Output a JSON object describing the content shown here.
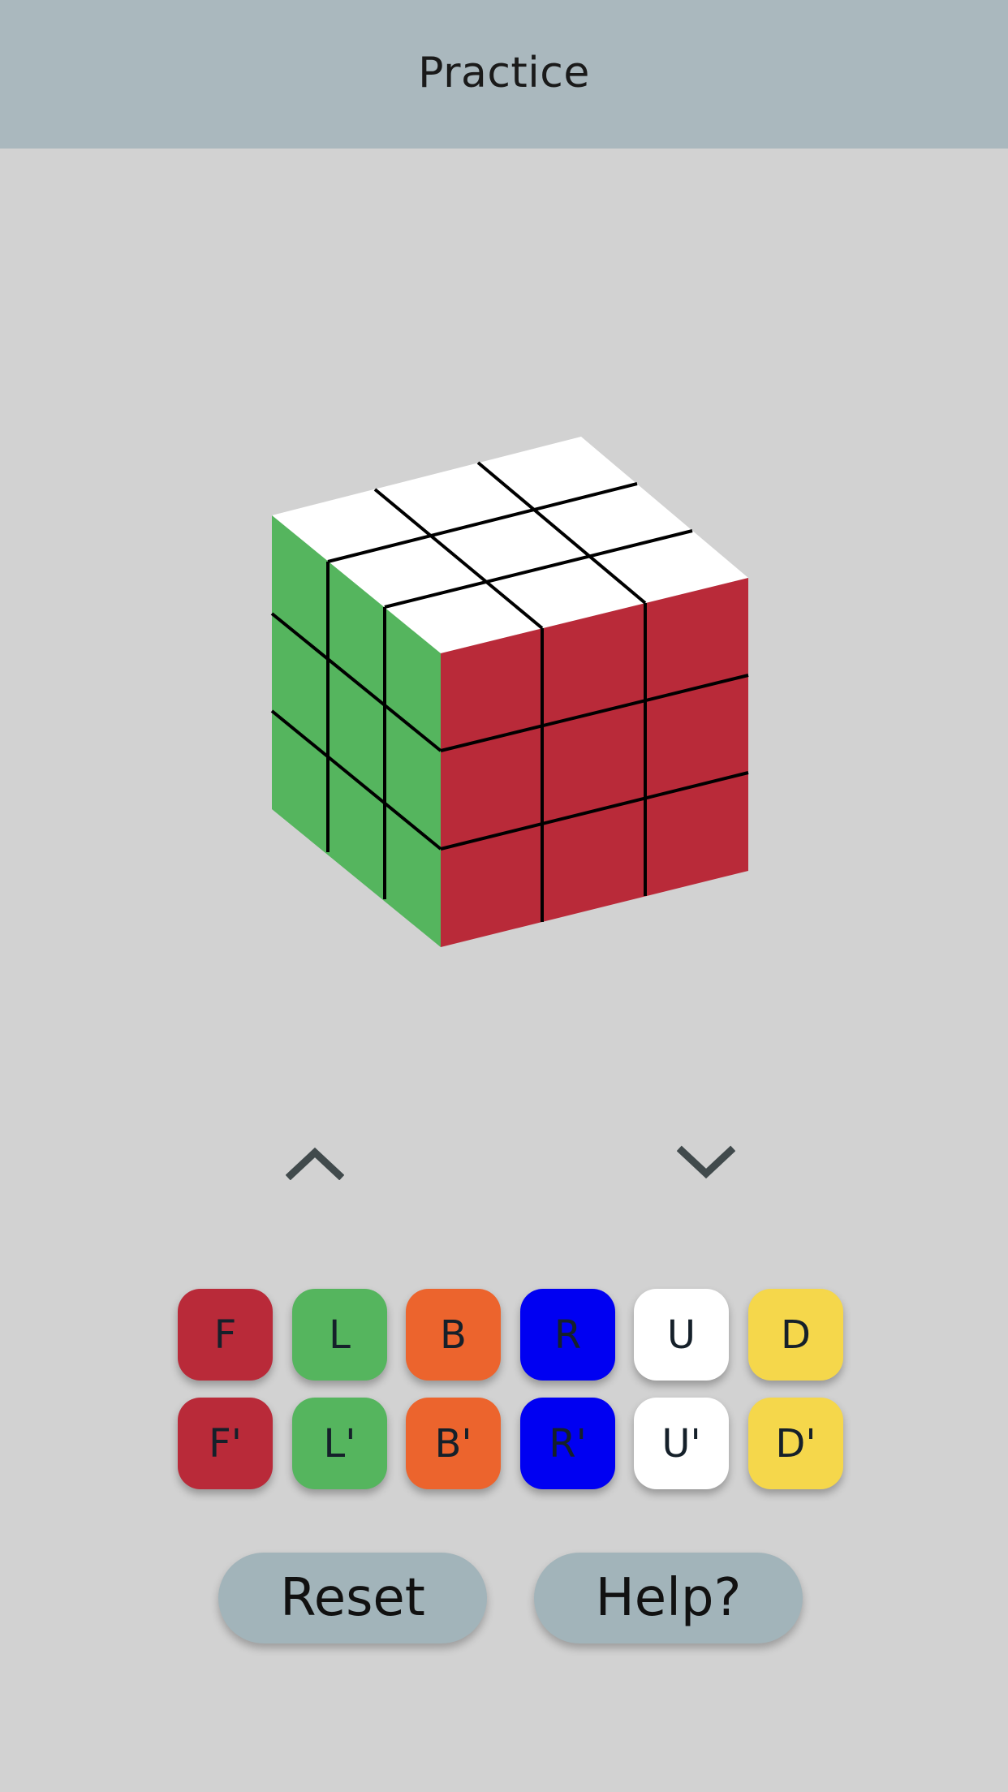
{
  "header": {
    "title": "Practice"
  },
  "cube": {
    "top_color": "#ffffff",
    "left_color": "#55b55e",
    "right_color": "#b92a39",
    "line_color": "#000000"
  },
  "controls": {
    "up_icon": "chevron-up-icon",
    "down_icon": "chevron-down-icon",
    "icon_color": "#414a4c"
  },
  "moves": {
    "row1": [
      {
        "label": "F",
        "color": "#b92a39"
      },
      {
        "label": "L",
        "color": "#55b55e"
      },
      {
        "label": "B",
        "color": "#ec642d"
      },
      {
        "label": "R",
        "color": "#0000f2"
      },
      {
        "label": "U",
        "color": "#ffffff"
      },
      {
        "label": "D",
        "color": "#f5d74b"
      }
    ],
    "row2": [
      {
        "label": "F'",
        "color": "#b92a39"
      },
      {
        "label": "L'",
        "color": "#55b55e"
      },
      {
        "label": "B'",
        "color": "#ec642d"
      },
      {
        "label": "R'",
        "color": "#0000f2"
      },
      {
        "label": "U'",
        "color": "#ffffff"
      },
      {
        "label": "D'",
        "color": "#f5d74b"
      }
    ]
  },
  "actions": {
    "reset_label": "Reset",
    "help_label": "Help?"
  }
}
